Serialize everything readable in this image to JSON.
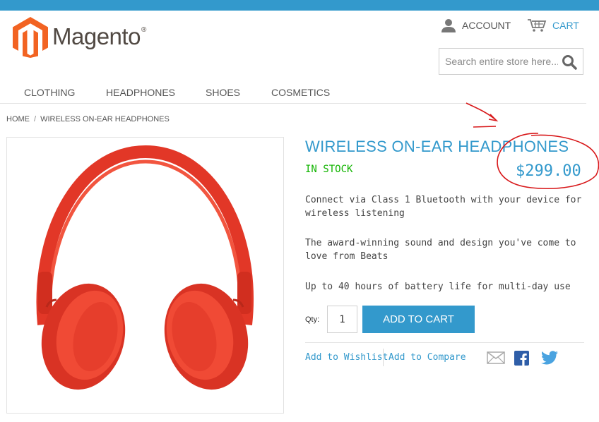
{
  "header": {
    "logo_text": "Magento",
    "logo_reg": "®",
    "account_label": "ACCOUNT",
    "cart_label": "CART",
    "search_placeholder": "Search entire store here..."
  },
  "nav": {
    "items": [
      "CLOTHING",
      "HEADPHONES",
      "SHOES",
      "COSMETICS"
    ]
  },
  "breadcrumb": {
    "home": "HOME",
    "separator": "/",
    "current": "WIRELESS ON-EAR HEADPHONES"
  },
  "product": {
    "title": "WIRELESS ON-EAR HEADPHONES",
    "stock": "IN STOCK",
    "price": "$299.00",
    "descriptions": [
      "Connect via Class 1 Bluetooth with your device for wireless listening",
      "The award-winning sound and design you've come to love from Beats",
      "Up to 40 hours of battery life for multi-day use"
    ],
    "qty_label": "Qty:",
    "qty_value": "1",
    "add_to_cart_label": "ADD TO CART",
    "wishlist_label": "Add to Wishlist",
    "compare_label": "Add to Compare"
  },
  "icons": {
    "logo": "magento-logo-icon",
    "account": "user-icon",
    "cart": "cart-icon",
    "search": "search-icon",
    "email": "email-icon",
    "facebook": "facebook-icon",
    "twitter": "twitter-icon"
  },
  "colors": {
    "accent": "#3399cc",
    "logo_orange": "#f26322",
    "in_stock": "#11b400",
    "annotation": "#d8191b",
    "headphones": "#e8372a"
  }
}
